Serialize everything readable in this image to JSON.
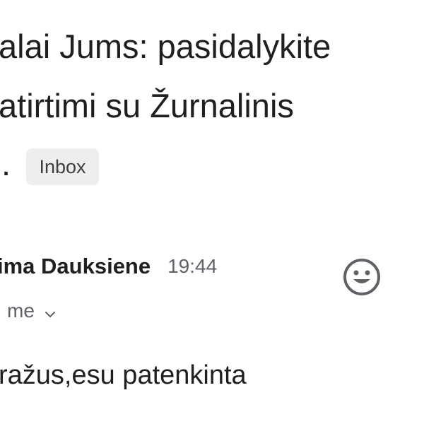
{
  "subject": {
    "line1": "alai Jums: pasidalykite",
    "line2": "atirtimi su Žurnalinis",
    "trail": "."
  },
  "label": "Inbox",
  "message": {
    "sender": "ima Dauksiene",
    "time": "19:44",
    "recipient": "me",
    "body": "ražus,esu patenkinta"
  },
  "icons": {
    "avatar": "smiley-face-icon",
    "recipient_toggle": "chevron-down-icon"
  },
  "colors": {
    "text": "#1f1f1f",
    "secondary": "#5f6368",
    "chip_bg": "#eeeeee",
    "avatar": "#5f6368"
  }
}
